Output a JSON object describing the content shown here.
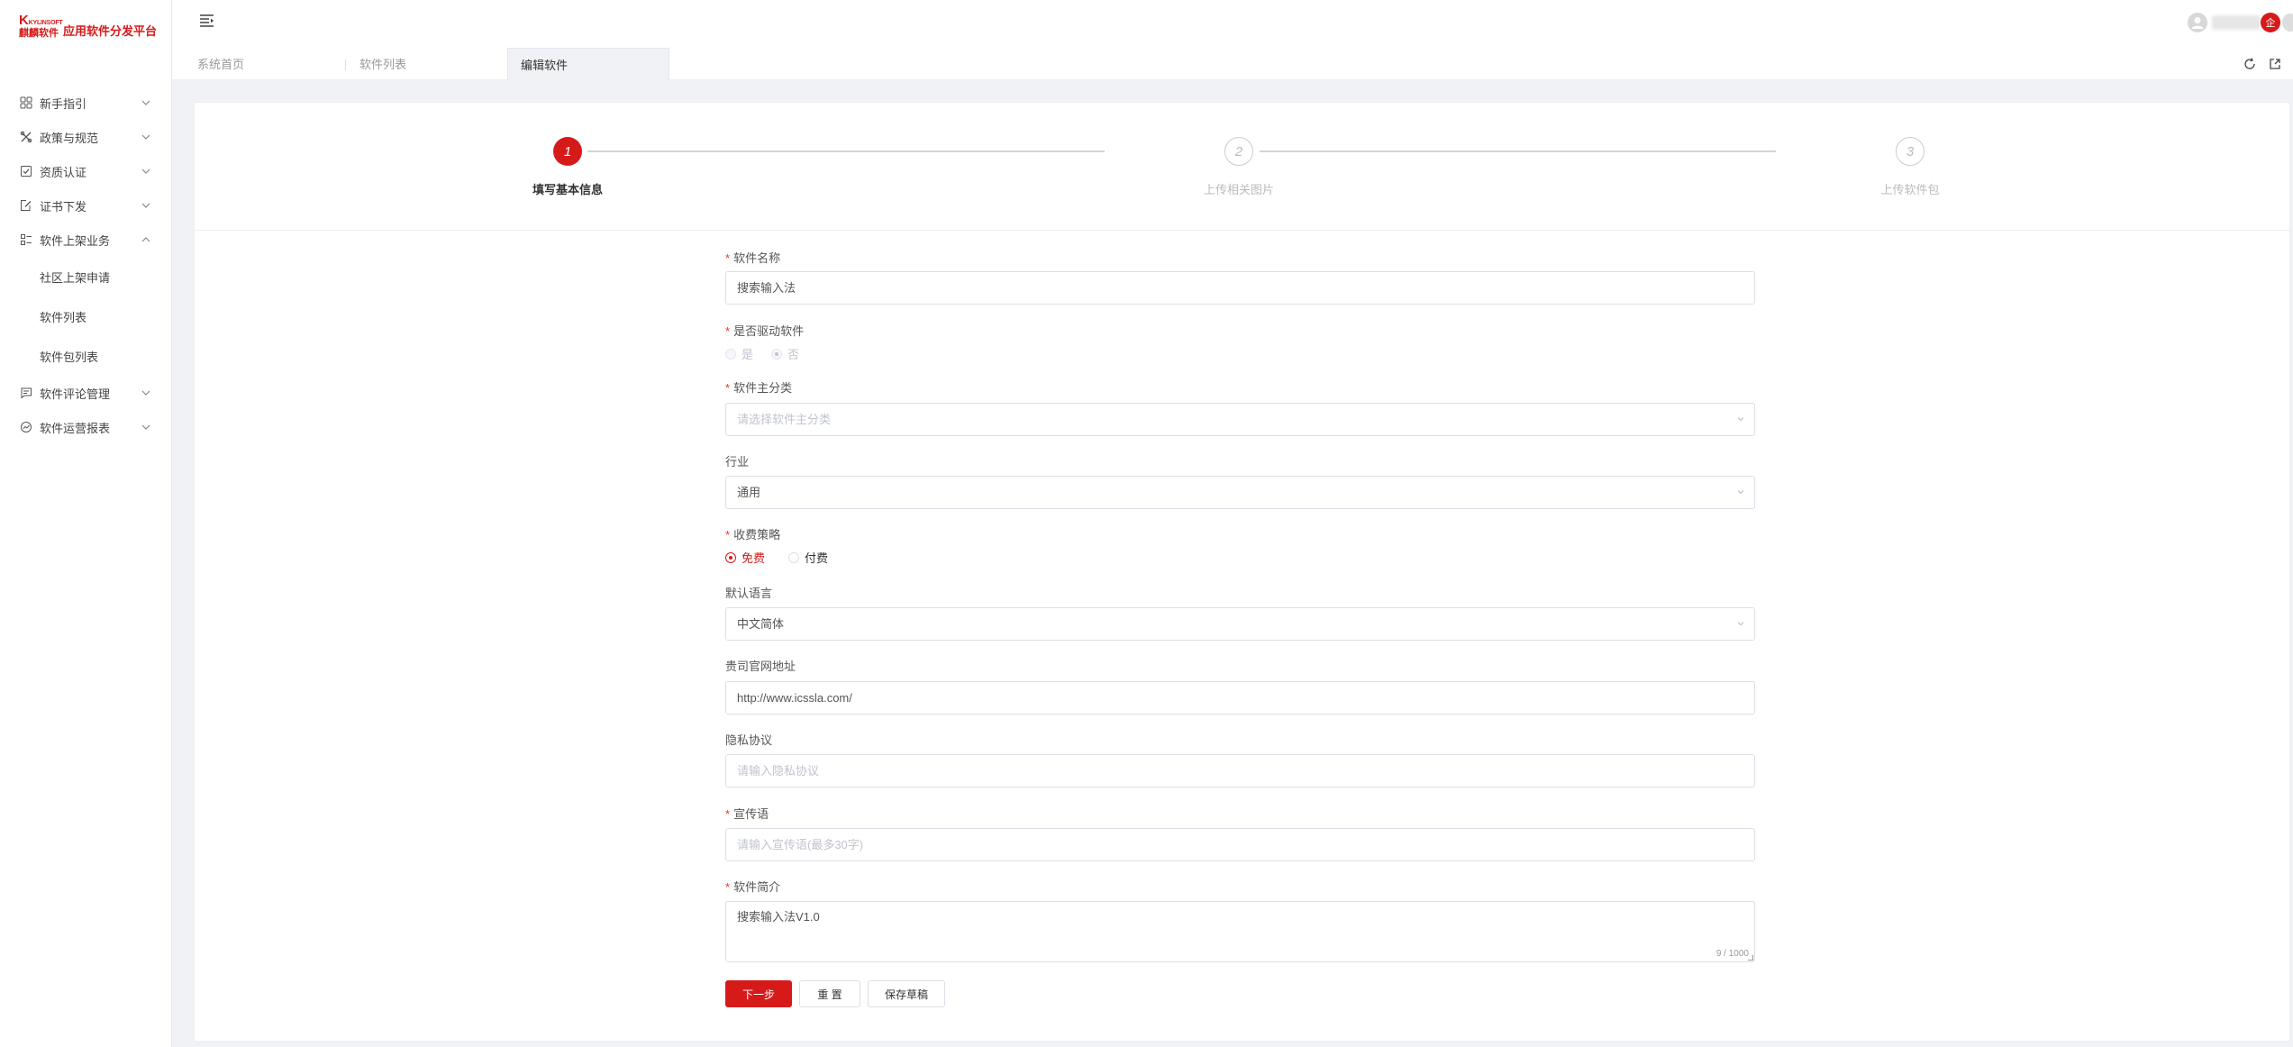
{
  "brand": {
    "logo_en": "KYLINSOFT",
    "logo_cn": "麒麟软件",
    "platform_title": "应用软件分发平台"
  },
  "header": {
    "corp_badge": "企"
  },
  "sidebar": {
    "items": [
      {
        "label": "新手指引",
        "icon": "grid-icon"
      },
      {
        "label": "政策与规范",
        "icon": "tools-icon"
      },
      {
        "label": "资质认证",
        "icon": "certificate-icon"
      },
      {
        "label": "证书下发",
        "icon": "edit-doc-icon"
      },
      {
        "label": "软件上架业务",
        "icon": "list-icon"
      }
    ],
    "subitems": [
      {
        "label": "社区上架申请"
      },
      {
        "label": "软件列表"
      },
      {
        "label": "软件包列表"
      }
    ],
    "items_after": [
      {
        "label": "软件评论管理",
        "icon": "comment-icon"
      },
      {
        "label": "软件运营报表",
        "icon": "chart-icon"
      }
    ]
  },
  "tabs": [
    {
      "label": "系统首页"
    },
    {
      "label": "软件列表"
    },
    {
      "label": "编辑软件"
    }
  ],
  "steps": [
    {
      "number": "1",
      "label": "填写基本信息"
    },
    {
      "number": "2",
      "label": "上传相关图片"
    },
    {
      "number": "3",
      "label": "上传软件包"
    }
  ],
  "form": {
    "name": {
      "label": "软件名称",
      "value": "搜索输入法"
    },
    "driver": {
      "label": "是否驱动软件",
      "options": [
        "是",
        "否"
      ],
      "selected": "否"
    },
    "category": {
      "label": "软件主分类",
      "placeholder": "请选择软件主分类"
    },
    "industry": {
      "label": "行业",
      "value": "通用"
    },
    "fee": {
      "label": "收费策略",
      "options": [
        "免费",
        "付费"
      ],
      "selected": "免费"
    },
    "language": {
      "label": "默认语言",
      "value": "中文简体"
    },
    "website": {
      "label": "贵司官网地址",
      "value": "http://www.icssla.com/"
    },
    "privacy": {
      "label": "隐私协议",
      "placeholder": "请输入隐私协议"
    },
    "slogan": {
      "label": "宣传语",
      "placeholder": "请输入宣传语(最多30字)"
    },
    "intro": {
      "label": "软件简介",
      "value": "搜索输入法V1.0",
      "counter": "9 / 1000"
    }
  },
  "buttons": {
    "next": "下一步",
    "reset": "重 置",
    "save_draft": "保存草稿"
  },
  "colors": {
    "brand_red": "#d61a1a",
    "content_bg": "#f0f2f5"
  }
}
